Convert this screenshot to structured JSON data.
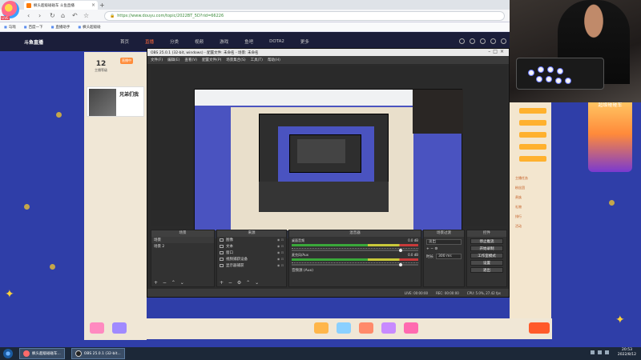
{
  "browser": {
    "badge_label": "LIVE",
    "tab_title": "枫头超级碰碰车 斗鱼直播",
    "url": "https://www.douyu.com/topic/2022BT_5D?rid=66226",
    "bookmarks": [
      "马戏",
      "百度一下",
      "直播助手",
      "枫头超级碰"
    ]
  },
  "site": {
    "brand": "斗鱼直播",
    "nav": [
      "首页",
      "直播",
      "分类",
      "视频",
      "游戏",
      "鱼吧",
      "DOTA2",
      "更多"
    ],
    "active_nav": 1
  },
  "room": {
    "stat_value": "12",
    "stat_label": "主播等级",
    "badge": "直播中",
    "streamer_name": "兄弟们我"
  },
  "obs": {
    "title": "OBS 25.0.1 (32-bit, windows) - 配置文件: 未命名 - 场景: 未命名",
    "menu": [
      "文件(F)",
      "编辑(E)",
      "查看(V)",
      "配置文件(P)",
      "场景集合(S)",
      "工具(T)",
      "帮助(H)"
    ],
    "docks": {
      "scenes": {
        "title": "场景",
        "items": [
          "场景",
          "场景 2"
        ]
      },
      "sources": {
        "title": "来源",
        "items": [
          "图像",
          "文本",
          "窗口",
          "视频捕获设备",
          "显示器捕获"
        ]
      },
      "mixer": {
        "title": "混音器",
        "channels": [
          {
            "name": "桌面音频",
            "level": "0.0 dB"
          },
          {
            "name": "麦克风/Aux",
            "level": "0.0 dB"
          }
        ],
        "footer": "音频源 (Aux)"
      },
      "transitions": {
        "title": "场景过渡",
        "type": "淡出",
        "duration_label": "时长",
        "duration": "300 ms"
      },
      "controls": {
        "title": "控件",
        "buttons": [
          "停止推流",
          "开始录制",
          "工作室模式",
          "设置",
          "退出"
        ]
      }
    },
    "status": {
      "live": "LIVE: 00:00:00",
      "rec": "REC: 00:00:00",
      "cpu": "CPU: 5.0%, 27.42 fps"
    }
  },
  "taskbar": {
    "tasks": [
      "枫头超级碰碰车...",
      "OBS 25.0.1 (32-bit..."
    ],
    "time": "20:53",
    "date": "2022/8/12"
  },
  "side_rows": [
    "主播任务",
    "粉丝团",
    "贵族",
    "礼物",
    "排行",
    "活动"
  ],
  "gift_badge": "超级碰碰车"
}
